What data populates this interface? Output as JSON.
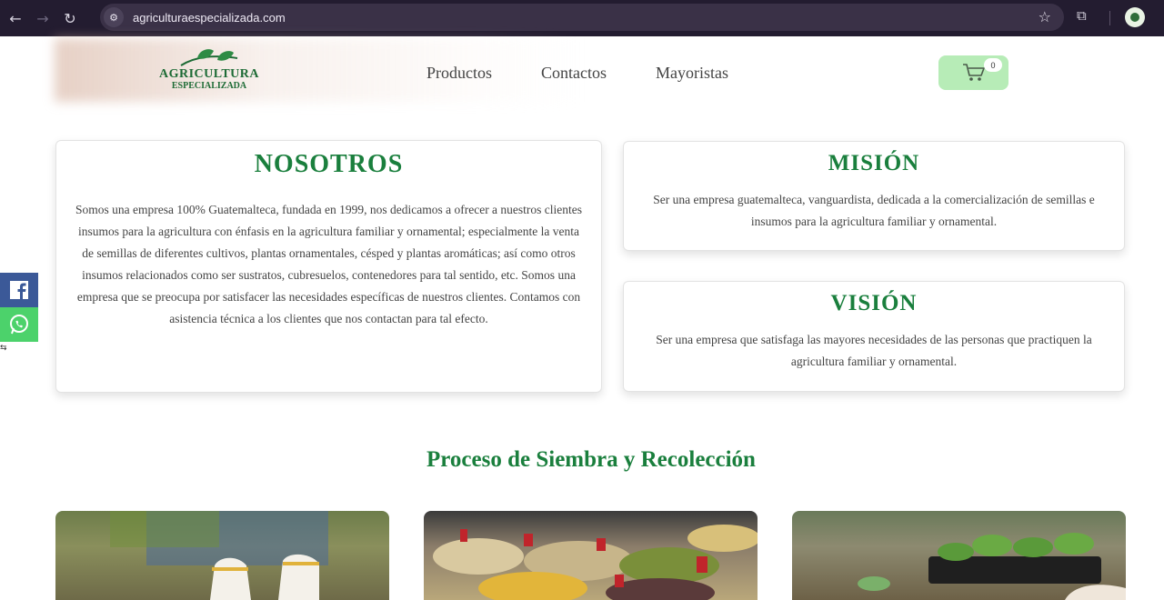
{
  "browser": {
    "url": "agriculturaespecializada.com"
  },
  "header": {
    "logo_line1": "AGRICULTURA",
    "logo_line2": "ESPECIALIZADA",
    "menu": [
      "Productos",
      "Contactos",
      "Mayoristas"
    ],
    "cart_count": "0"
  },
  "nosotros": {
    "title": "NOSOTROS",
    "text": "Somos una empresa 100% Guatemalteca, fundada en 1999, nos dedicamos a ofrecer a nuestros clientes insumos para la agricultura con énfasis en la agricultura familiar y ornamental; especialmente la venta de semillas de diferentes cultivos, plantas ornamentales, césped y plantas aromáticas; así como otros insumos relacionados como ser sustratos, cubresuelos, contenedores para tal sentido, etc. Somos una empresa que se preocupa por satisfacer las necesidades específicas de nuestros clientes. Contamos con asistencia técnica a los clientes que nos contactan para tal efecto."
  },
  "mision": {
    "title": "MISIÓN",
    "text": "Ser una empresa guatemalteca, vanguardista, dedicada a la comercialización de semillas e insumos para la agricultura familiar y ornamental."
  },
  "vision": {
    "title": "VISIÓN",
    "text": "Ser una empresa que satisfaga las mayores necesidades de las personas que practiquen la agricultura familiar y ornamental."
  },
  "proceso": {
    "title": "Proceso de Siembra y Recolección"
  },
  "colors": {
    "brand_green": "#1a7f3d",
    "cart_bg": "#b7ecb7",
    "facebook": "#3b5998",
    "whatsapp": "#4cd26b"
  }
}
